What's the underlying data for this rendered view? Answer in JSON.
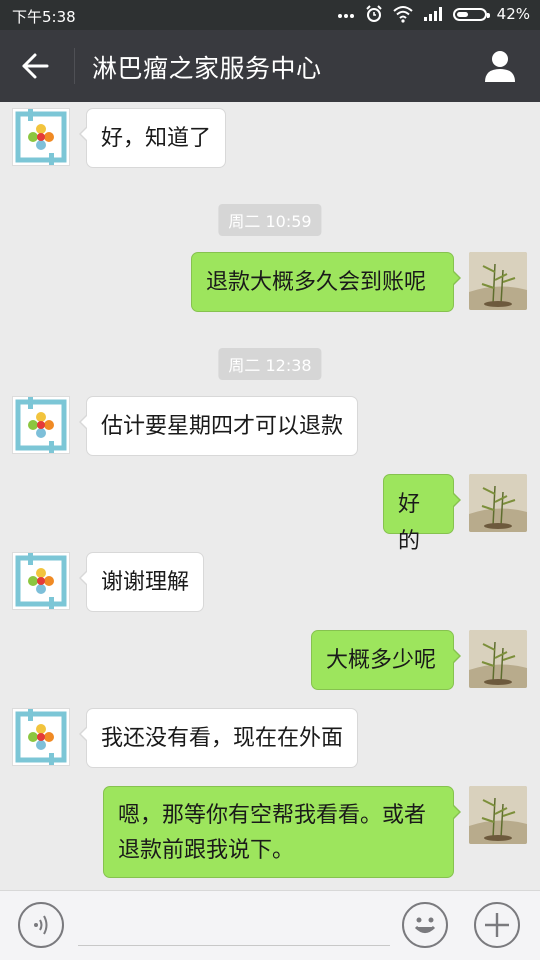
{
  "status_bar": {
    "time": "下午5:38",
    "battery_percent": "42%",
    "battery_level": 0.42,
    "icons": [
      "dots-icon",
      "alarm-icon",
      "wifi-icon",
      "signal-icon",
      "battery-icon"
    ]
  },
  "header": {
    "title": "淋巴瘤之家服务中心",
    "back_icon": "back-arrow-icon",
    "profile_icon": "person-icon"
  },
  "messages": [
    {
      "side": "left",
      "text": "好，知道了"
    },
    {
      "timestamp": "周二 10:59"
    },
    {
      "side": "right",
      "text": "退款大概多久会到账呢"
    },
    {
      "timestamp": "周二 12:38"
    },
    {
      "side": "left",
      "text": "估计要星期四才可以退款"
    },
    {
      "side": "right",
      "text": "好的"
    },
    {
      "side": "left",
      "text": "谢谢理解"
    },
    {
      "side": "right",
      "text": "大概多少呢"
    },
    {
      "side": "left",
      "text": "我还没有看，现在在外面"
    },
    {
      "side": "right",
      "text_lines": [
        "嗯，那等你有空帮我看看。或者",
        "退款前跟我说下。"
      ]
    }
  ],
  "input_bar": {
    "voice_icon": "voice-icon",
    "emoji_icon": "emoji-icon",
    "add_icon": "plus-icon",
    "input_value": ""
  },
  "colors": {
    "status_bar": "#2e3132",
    "header": "#393a3f",
    "chat_bg": "#ebebeb",
    "bubble_sent": "#9de55d",
    "bubble_received": "#ffffff",
    "timestamp_bg": "#d6d6d6"
  }
}
